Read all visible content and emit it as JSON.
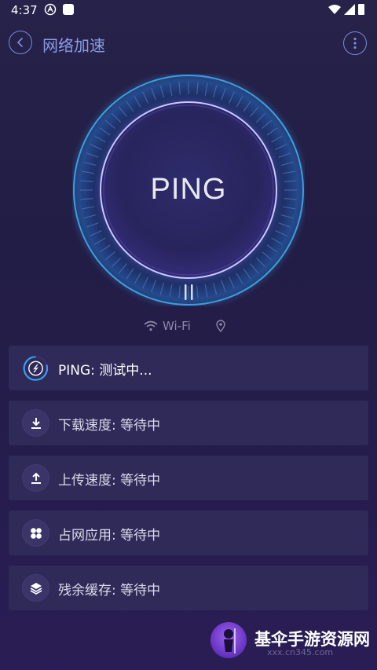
{
  "status_bar": {
    "time": "4:37"
  },
  "header": {
    "title": "网络加速"
  },
  "dial": {
    "label": "PING"
  },
  "network": {
    "type": "Wi-Fi"
  },
  "rows": [
    {
      "icon": "speedometer-icon",
      "text": "PING: 测试中..."
    },
    {
      "icon": "download-icon",
      "text": "下载速度: 等待中"
    },
    {
      "icon": "upload-icon",
      "text": "上传速度: 等待中"
    },
    {
      "icon": "apps-grid-icon",
      "text": "占网应用: 等待中"
    },
    {
      "icon": "layers-icon",
      "text": "残余缓存: 等待中"
    }
  ],
  "watermark": {
    "text": "基伞手游资源网",
    "sub": "xxx.cn345.com"
  },
  "colors": {
    "accent": "#7b8bd8",
    "background": "#231e47",
    "row_bg": "#2f2a58",
    "dial_glow": "#3fa0e8"
  }
}
